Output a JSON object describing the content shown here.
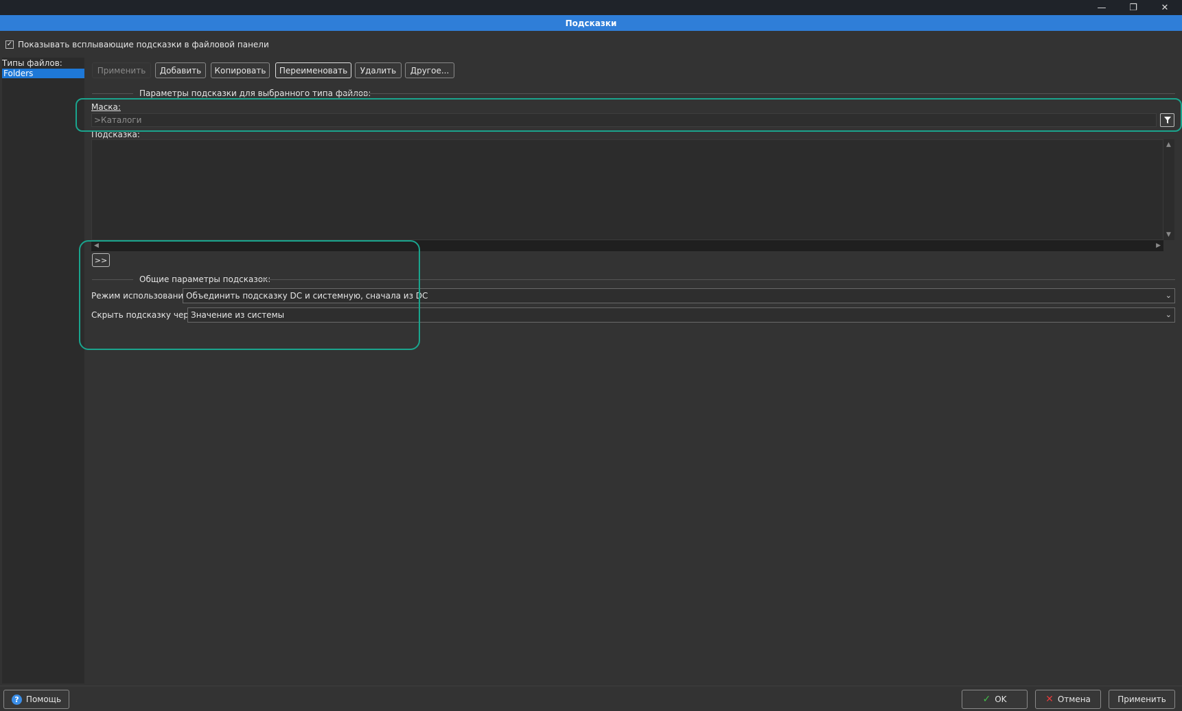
{
  "window": {
    "title": "Подсказки",
    "controls": {
      "minimize_icon": "minimize-icon",
      "restore_icon": "restore-icon",
      "close_icon": "close-icon"
    }
  },
  "show_tooltips": {
    "label": "Показывать всплывающие подсказки в файловой панели",
    "checked": true
  },
  "file_types": {
    "label": "Типы файлов:",
    "items": [
      "Folders"
    ],
    "selected": "Folders"
  },
  "toolbar": {
    "apply": "Применить",
    "add": "Добавить",
    "copy": "Копировать",
    "rename": "Переименовать",
    "delete": "Удалить",
    "other": "Другое..."
  },
  "selected_params": {
    "group_title": "Параметры подсказки для выбранного типа файлов:",
    "mask_label": "Маска:",
    "mask_value": ">Каталоги",
    "hint_label": "Подсказка:",
    "hint_value": "",
    "more_button": ">>"
  },
  "general_params": {
    "group_title": "Общие параметры подсказок:",
    "mode_label": "Режим использования:",
    "mode_value": "Объединить подсказку DC и системную, сначала из DC",
    "hide_label": "Скрыть подсказку через:",
    "hide_value": "Значение из системы"
  },
  "footer": {
    "help": "Помощь",
    "ok": "OK",
    "cancel": "Отмена",
    "apply": "Применить"
  },
  "colors": {
    "accent": "#2f7ed8",
    "highlight": "#1aa58e",
    "selection": "#1e78d7"
  }
}
